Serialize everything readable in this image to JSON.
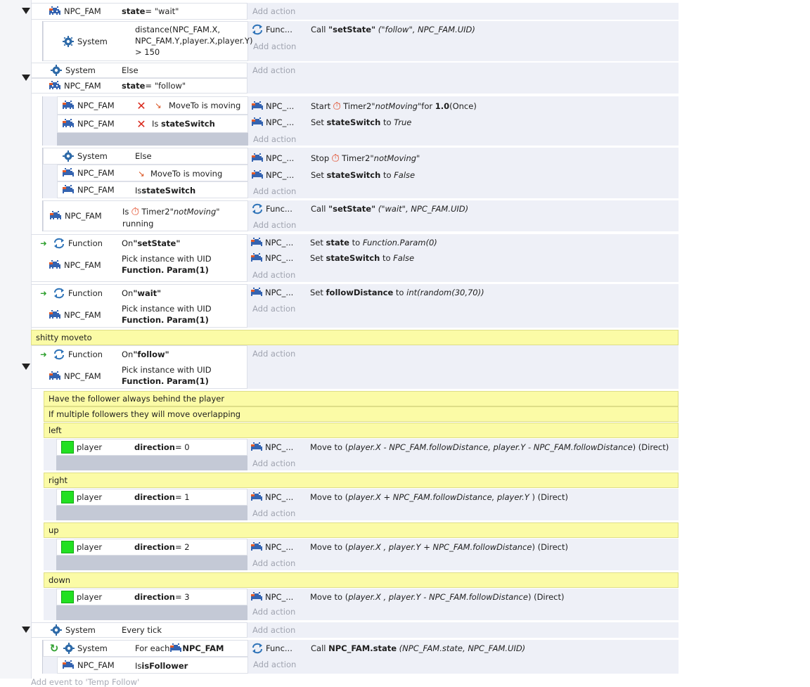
{
  "objects": {
    "npc": "NPC_FAM",
    "system": "System",
    "function": "Function",
    "player": "player",
    "npc_short": "NPC_...",
    "func_short": "Func..."
  },
  "common": {
    "add_action": "Add action",
    "else": "Else"
  },
  "ev1": {
    "cond_a": "state",
    "cond_b": " = \"wait\""
  },
  "ev1sub": {
    "cond": "distance(NPC_FAM.X, NPC_FAM.Y,player.X,player.Y) > 150",
    "act_a": "Call ",
    "act_b": "\"setState\"",
    "act_c": " (\"follow\", NPC_FAM.UID)"
  },
  "ev2": {
    "cond_a": "state",
    "cond_b": " = \"follow\""
  },
  "ev2s1": {
    "c1": "MoveTo is moving",
    "c2_a": "Is ",
    "c2_b": "stateSwitch",
    "a1_a": "Start ",
    "a1_b": "Timer2 ",
    "a1_c": "\"notMoving\"",
    "a1_d": " for ",
    "a1_e": "1.0",
    "a1_f": " (Once)",
    "a2_a": "Set ",
    "a2_b": "stateSwitch",
    "a2_c": " to ",
    "a2_d": "True"
  },
  "ev2s2": {
    "c2": "MoveTo is moving",
    "c3_a": "Is ",
    "c3_b": "stateSwitch",
    "a1_a": "Stop ",
    "a1_b": "Timer2 ",
    "a1_c": "\"notMoving\"",
    "a2_a": "Set ",
    "a2_b": "stateSwitch",
    "a2_c": " to ",
    "a2_d": "False"
  },
  "ev2s3": {
    "c_a": "Is ",
    "c_b": "Timer2 ",
    "c_c": "\"notMoving\"",
    "c_d": "running",
    "a_a": "Call ",
    "a_b": "\"setState\"",
    "a_c": " (\"wait\", NPC_FAM.UID)"
  },
  "fn1": {
    "c1_a": "On ",
    "c1_b": "\"setState\"",
    "c2_a": "Pick instance with UID ",
    "c2_b": "Function.",
    "c2_c": "Param(1)",
    "a1_a": "Set ",
    "a1_b": "state",
    "a1_c": " to ",
    "a1_d": "Function.Param(0)",
    "a2_a": "Set ",
    "a2_b": "stateSwitch",
    "a2_c": " to ",
    "a2_d": "False"
  },
  "fn2": {
    "c1_a": "On ",
    "c1_b": "\"wait\"",
    "c2_a": "Pick instance with UID ",
    "c2_b": "Function.",
    "c2_c": "Param(1)",
    "a1_a": "Set ",
    "a1_b": "followDistance",
    "a1_c": " to ",
    "a1_d": "int(random(30,70))"
  },
  "comment_moveto": "shitty moveto",
  "fn3": {
    "c1_a": "On ",
    "c1_b": "\"follow\"",
    "c2_a": "Pick instance with UID ",
    "c2_b": "Function.",
    "c2_c": "Param(1)"
  },
  "comments": {
    "behind": "Have the follower always behind the player",
    "overlap": "If multiple followers they will move overlapping",
    "left": "left",
    "right": "right",
    "up": "up",
    "down": "down"
  },
  "dir": {
    "label": "direction",
    "eq0": " = 0",
    "eq1": " = 1",
    "eq2": " = 2",
    "eq3": " = 3",
    "move": "Move to ",
    "m0_a": "(",
    "m0_b": "player.X - NPC_FAM.followDistance, player.Y - NPC_FAM.followDistance",
    "m0_c": ") (Direct)",
    "m1_a": "(",
    "m1_b": "player.X + NPC_FAM.followDistance, player.Y ",
    "m1_c": ") (Direct)",
    "m2_a": "(",
    "m2_b": "player.X , player.Y + NPC_FAM.followDistance",
    "m2_c": ") (Direct)",
    "m3_a": "(",
    "m3_b": "player.X , player.Y - NPC_FAM.followDistance",
    "m3_c": ") (Direct)"
  },
  "tick": {
    "cond": "Every tick",
    "foreach": "For each ",
    "is_a": "Is ",
    "is_b": "isFollower",
    "call_a": "Call ",
    "call_b": "NPC_FAM.state",
    "call_c": " (NPC_FAM.state, NPC_FAM.UID)"
  },
  "footer": "Add event to 'Temp Follow'",
  "colors": {
    "sheet_bg": "#eef0f7",
    "comment": "#fbfba6",
    "player_sprite": "#22e022",
    "add_action": "#a0a4b0",
    "timer_icon": "#e0401c"
  }
}
